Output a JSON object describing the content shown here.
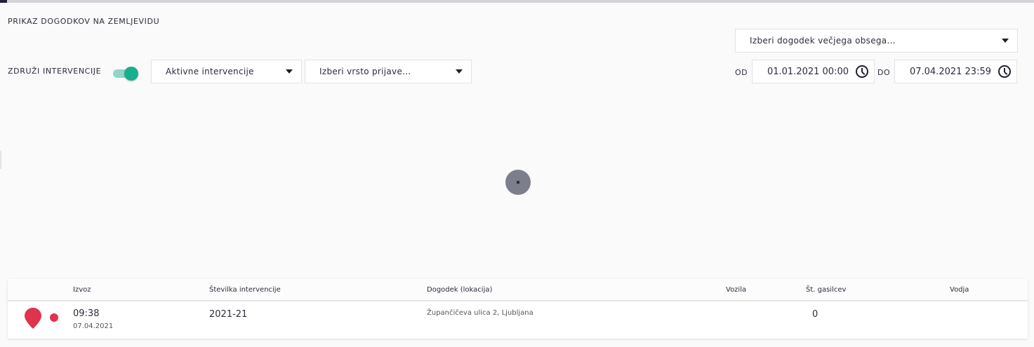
{
  "header": {
    "title": "PRIKAZ DOGODKOV NA ZEMLJEVIDU"
  },
  "filters": {
    "large_event": "Izberi dogodek večjega obsega...",
    "merge_label": "ZDRUŽI INTERVENCIJE",
    "merge_enabled": true,
    "status": "Aktivne intervencije",
    "report_type": "Izberi vrsto prijave...",
    "from_label": "OD",
    "from_value": "01.01.2021 00:00",
    "to_label": "DO",
    "to_value": "07.04.2021 23:59"
  },
  "colors": {
    "accent": "#17b08c",
    "marker": "#e0334e"
  },
  "table": {
    "columns": [
      "Izvoz",
      "Številka intervencije",
      "Dogodek (lokacija)",
      "Vozila",
      "Št. gasilcev",
      "Vodja"
    ],
    "rows": [
      {
        "time": "09:38",
        "date": "07.04.2021",
        "number": "2021-21",
        "location": "Župančičeva ulica 2, Ljubljana",
        "vehicles": "",
        "firefighters": "0",
        "leader": ""
      }
    ]
  }
}
